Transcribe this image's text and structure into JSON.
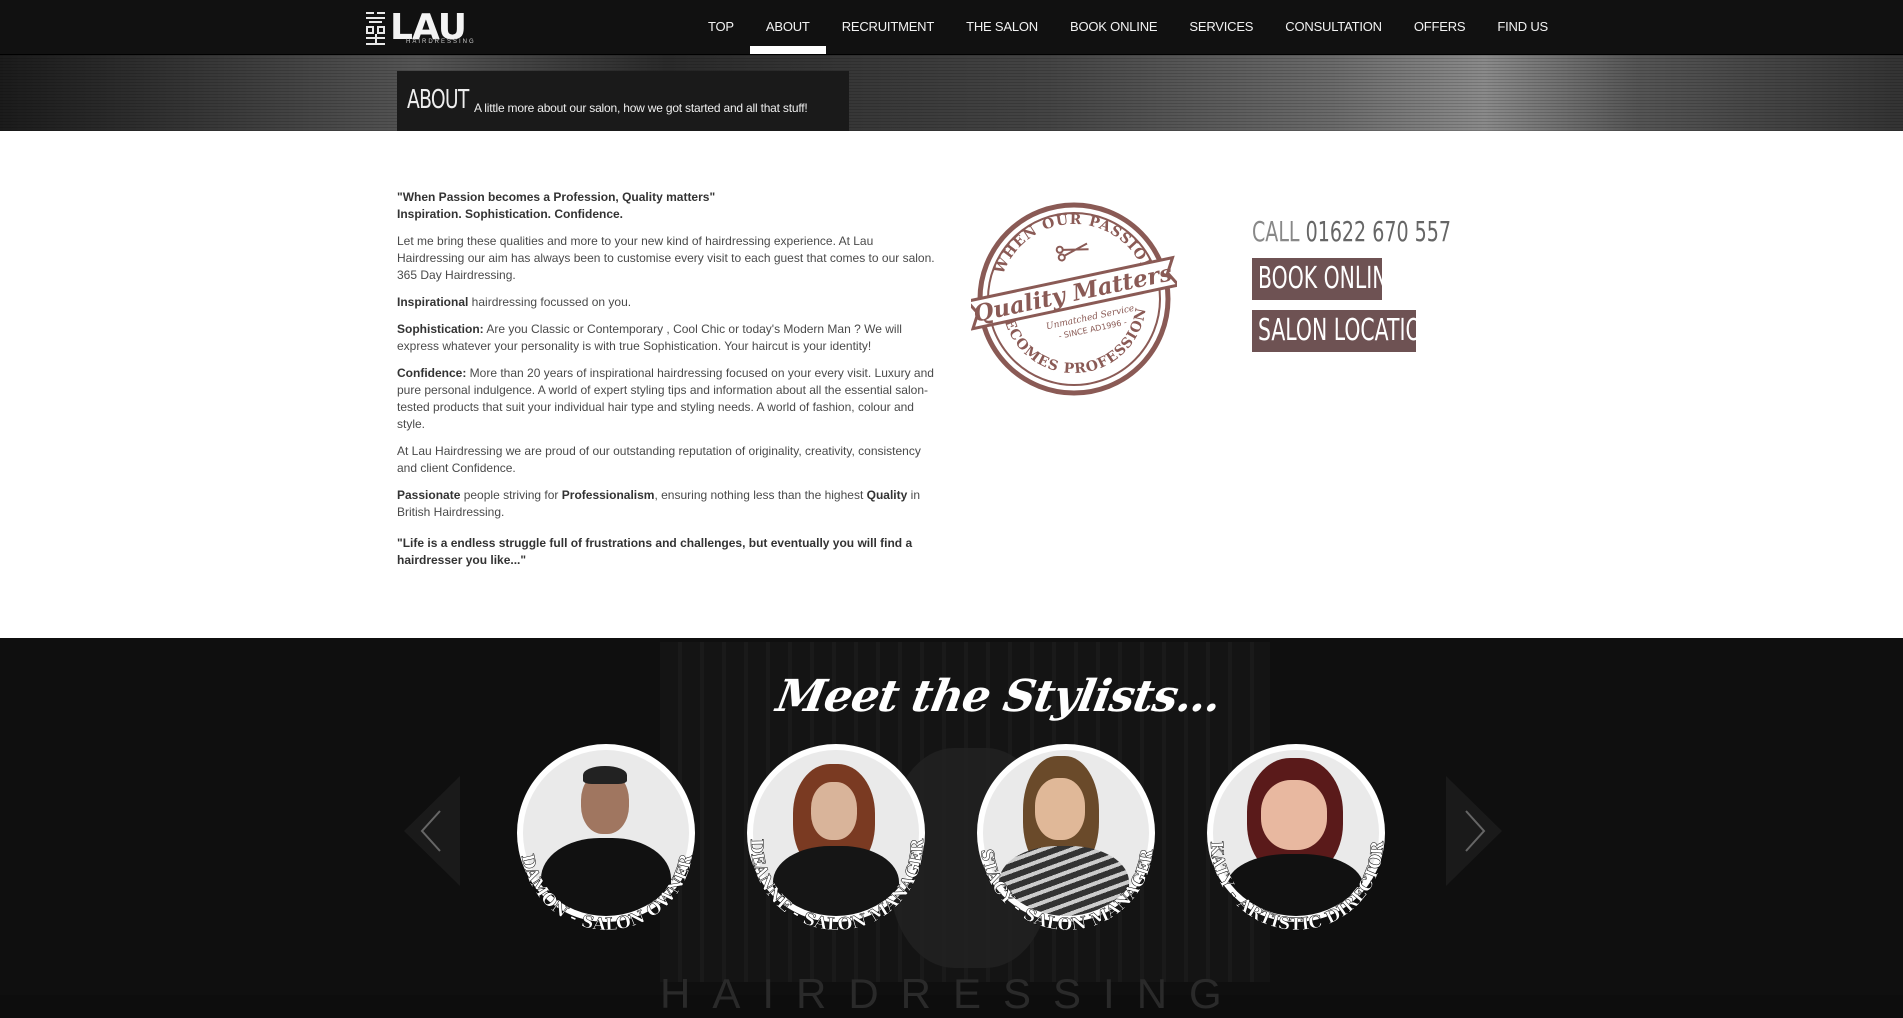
{
  "brand": {
    "name": "LAU",
    "tagline": "HAIRDRESSING"
  },
  "nav": [
    {
      "label": "TOP"
    },
    {
      "label": "ABOUT",
      "active": true
    },
    {
      "label": "RECRUITMENT"
    },
    {
      "label": "THE SALON"
    },
    {
      "label": "BOOK ONLINE"
    },
    {
      "label": "SERVICES"
    },
    {
      "label": "CONSULTATION"
    },
    {
      "label": "OFFERS"
    },
    {
      "label": "FIND US"
    }
  ],
  "hero": {
    "title": "ABOUT",
    "subtitle": "A little more about our salon, how we got started and all that stuff!"
  },
  "content": {
    "quote_top": "\"When Passion becomes a Profession, Quality matters\"",
    "quote_top_2": "Inspiration. Sophistication. Confidence.",
    "p1": "Let me bring these qualities and more to your new kind of hairdressing experience. At Lau Hairdressing our aim has always been to customise every visit to each guest that comes to our salon. 365 Day Hairdressing.",
    "p2_bold": "Inspirational",
    "p2_rest": " hairdressing focussed on you.",
    "p3_bold": "Sophistication:",
    "p3_rest": " Are you Classic or Contemporary , Cool Chic or today's Modern Man ? We will express whatever your personality is with true Sophistication. Your haircut is your identity!",
    "p4_bold": "Confidence:",
    "p4_rest": " More than 20 years of inspirational hairdressing focused on your every visit. Luxury and pure personal indulgence. A world of expert styling tips and information about all the essential salon-tested products that suit your individual hair type and styling needs. A world of fashion, colour and style.",
    "p5": "At Lau Hairdressing we are proud of our outstanding reputation of originality, creativity, consistency and client Confidence.",
    "p6_b1": "Passionate",
    "p6_t1": " people striving for ",
    "p6_b2": "Professionalism",
    "p6_t2": ", ensuring nothing less than the highest ",
    "p6_b3": "Quality",
    "p6_t3": " in British Hairdressing.",
    "quote_bottom": "\"Life is a endless struggle full of frustrations and challenges, but eventually you will find a hairdresser you like...\""
  },
  "stamp": {
    "top_arc": "WHEN OUR PASSION",
    "center": "Quality Matters",
    "line1": "Unmatched Service",
    "line2": "- SINCE AD1996 -",
    "bottom_arc": "BECOMES PROFESSION",
    "color": "#8a5a55"
  },
  "cta": {
    "call_label": "CALL",
    "phone": "01622 670 557",
    "book_label": "BOOK ONLINE",
    "location_label": "SALON LOCATION",
    "button_color": "#6e5253"
  },
  "stylists_section": {
    "heading": "Meet the Stylists...",
    "footer_word": "HAIRDRESSING",
    "stylists": [
      {
        "label": "DAMON - SALON OWNER"
      },
      {
        "label": "DEANNE - SALON MANAGER"
      },
      {
        "label": "STACY - SALON MANAGER"
      },
      {
        "label": "KATY - ARTISTIC DIRECTOR"
      }
    ]
  }
}
